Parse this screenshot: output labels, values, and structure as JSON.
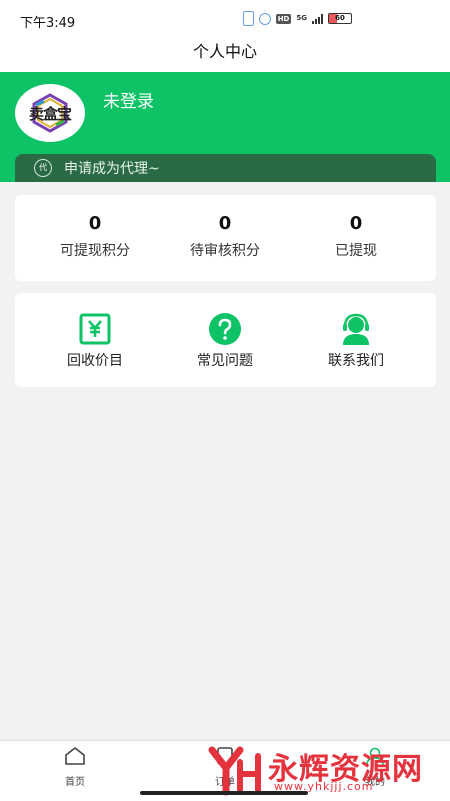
{
  "status_bar": {
    "time": "下午3:49",
    "network": "5G",
    "battery": "60"
  },
  "header": {
    "title": "个人中心"
  },
  "profile": {
    "avatar_text": "卖盒宝",
    "username": "未登录"
  },
  "agent_banner": {
    "badge": "代",
    "text": "申请成为代理~"
  },
  "points": [
    {
      "value": "0",
      "label": "可提现积分"
    },
    {
      "value": "0",
      "label": "待审核积分"
    },
    {
      "value": "0",
      "label": "已提现"
    }
  ],
  "functions": [
    {
      "icon": "yuan-receipt-icon",
      "label": "回收价目"
    },
    {
      "icon": "question-icon",
      "label": "常见问题"
    },
    {
      "icon": "customer-service-icon",
      "label": "联系我们"
    }
  ],
  "bottom_nav": [
    {
      "icon": "home-icon",
      "label": "首页"
    },
    {
      "icon": "order-icon",
      "label": "订单"
    },
    {
      "icon": "user-icon",
      "label": "我的"
    }
  ],
  "watermark": {
    "title": "永辉资源网",
    "url": "www.yhkjjj.com"
  },
  "colors": {
    "brand_green": "#0ec266",
    "agent_bar": "#2a6a44",
    "icon_green": "#0ec266",
    "watermark_red": "#e5333e"
  }
}
